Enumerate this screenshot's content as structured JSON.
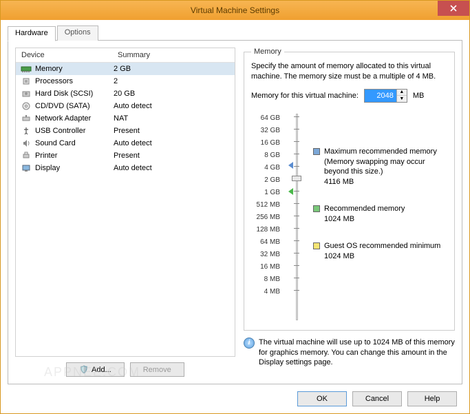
{
  "title": "Virtual Machine Settings",
  "tabs": {
    "hardware": "Hardware",
    "options": "Options"
  },
  "columns": {
    "device": "Device",
    "summary": "Summary"
  },
  "devices": [
    {
      "name": "Memory",
      "summary": "2 GB",
      "icon": "memory"
    },
    {
      "name": "Processors",
      "summary": "2",
      "icon": "cpu"
    },
    {
      "name": "Hard Disk (SCSI)",
      "summary": "20 GB",
      "icon": "hdd"
    },
    {
      "name": "CD/DVD (SATA)",
      "summary": "Auto detect",
      "icon": "cd"
    },
    {
      "name": "Network Adapter",
      "summary": "NAT",
      "icon": "net"
    },
    {
      "name": "USB Controller",
      "summary": "Present",
      "icon": "usb"
    },
    {
      "name": "Sound Card",
      "summary": "Auto detect",
      "icon": "sound"
    },
    {
      "name": "Printer",
      "summary": "Present",
      "icon": "printer"
    },
    {
      "name": "Display",
      "summary": "Auto detect",
      "icon": "display"
    }
  ],
  "buttons": {
    "add": "Add...",
    "remove": "Remove",
    "ok": "OK",
    "cancel": "Cancel",
    "help": "Help"
  },
  "memory": {
    "group": "Memory",
    "desc": "Specify the amount of memory allocated to this virtual machine. The memory size must be a multiple of 4 MB.",
    "field_label": "Memory for this virtual machine:",
    "value": "2048",
    "unit": "MB",
    "ticks": [
      "64 GB",
      "32 GB",
      "16 GB",
      "8 GB",
      "4 GB",
      "2 GB",
      "1 GB",
      "512 MB",
      "256 MB",
      "128 MB",
      "64 MB",
      "32 MB",
      "16 MB",
      "8 MB",
      "4 MB"
    ],
    "legend": {
      "max": {
        "label": "Maximum recommended memory",
        "note": "(Memory swapping may occur beyond this size.)",
        "value": "4116 MB"
      },
      "rec": {
        "label": "Recommended memory",
        "value": "1024 MB"
      },
      "min": {
        "label": "Guest OS recommended minimum",
        "value": "1024 MB"
      }
    },
    "info": "The virtual machine will use up to 1024 MB of this memory for graphics memory. You can change this amount in the Display settings page."
  },
  "watermark": "APPNEE.COM"
}
